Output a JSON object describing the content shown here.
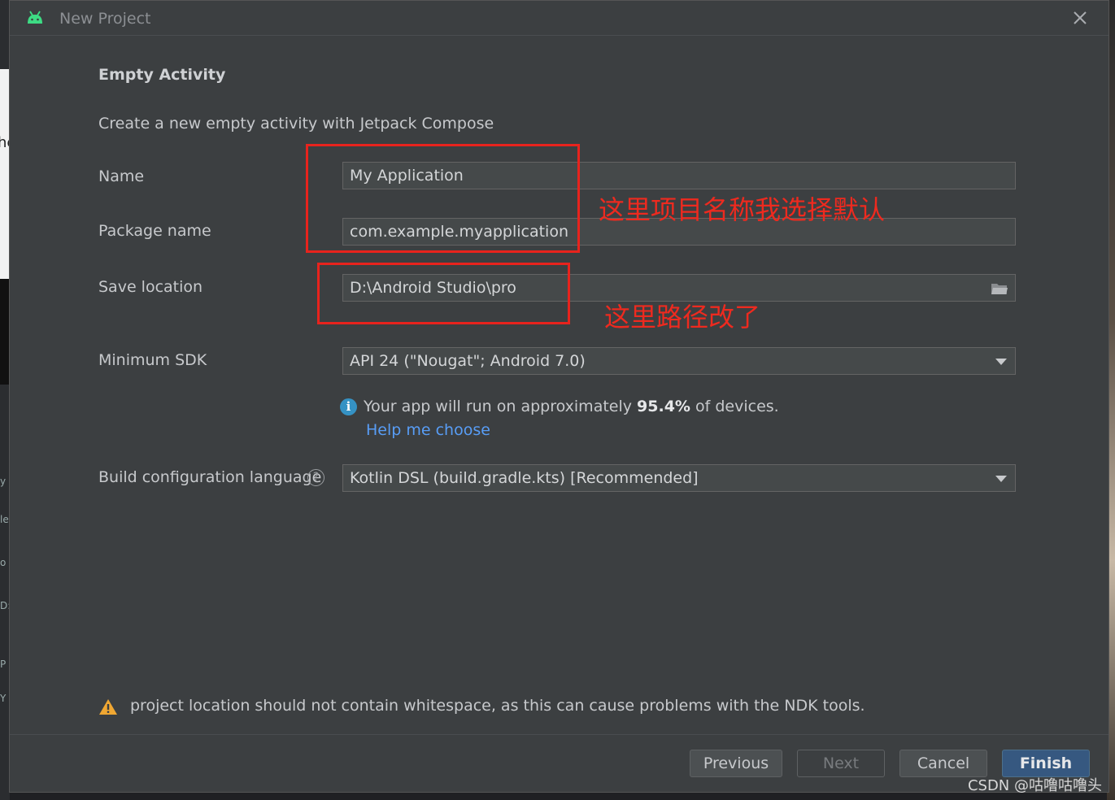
{
  "window": {
    "title": "New Project"
  },
  "page": {
    "section_title": "Empty Activity",
    "description": "Create a new empty activity with Jetpack Compose"
  },
  "form": {
    "name": {
      "label": "Name",
      "value": "My Application"
    },
    "package": {
      "label": "Package name",
      "value": "com.example.myapplication"
    },
    "save_location": {
      "label": "Save location",
      "value": "D:\\Android Studio\\pro"
    },
    "min_sdk": {
      "label": "Minimum SDK",
      "value": "API 24 (\"Nougat\"; Android 7.0)"
    },
    "info": {
      "prefix": "Your app will run on approximately ",
      "percent": "95.4%",
      "suffix": " of devices."
    },
    "help_link": "Help me choose",
    "build_lang": {
      "label": "Build configuration language",
      "value": "Kotlin DSL (build.gradle.kts) [Recommended]"
    }
  },
  "warning": "project location should not contain whitespace, as this can cause problems with the NDK tools.",
  "buttons": {
    "previous": "Previous",
    "next": "Next",
    "cancel": "Cancel",
    "finish": "Finish"
  },
  "annotations": {
    "name_note": "这里项目名称我选择默认",
    "path_note": "这里路径改了"
  },
  "watermark": "CSDN @咕噜咕噜头",
  "background_fragments": [
    "he",
    "y",
    "le",
    "o",
    "D:\\",
    "P",
    "Y"
  ],
  "colors": {
    "annotation": "#e8231d",
    "link": "#589df6",
    "primary_button": "#365880",
    "android_icon": "#3ddc84"
  }
}
